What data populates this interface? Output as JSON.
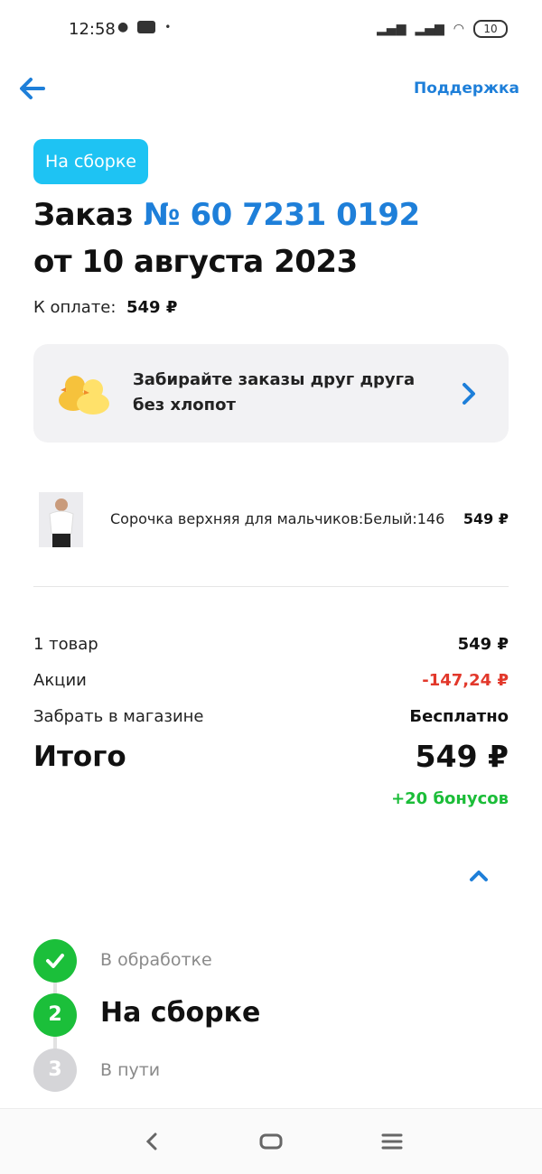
{
  "status_bar": {
    "time": "12:58",
    "battery": "10"
  },
  "header": {
    "support_label": "Поддержка"
  },
  "order": {
    "status_badge": "На сборке",
    "title_prefix": "Заказ",
    "number": "№ 60 7231 0192",
    "date": "от 10 августа 2023",
    "pay_label": "К оплате:",
    "pay_value": "549 ₽"
  },
  "promo_card": {
    "text": "Забирайте заказы друг друга без хлопот"
  },
  "product": {
    "name": "Сорочка верхняя для мальчиков:Белый:146",
    "price": "549 ₽"
  },
  "summary": {
    "items_label": "1 товар",
    "items_value": "549 ₽",
    "promos_label": "Акции",
    "promos_value": "-147,24 ₽",
    "pickup_label": "Забрать в магазине",
    "pickup_value": "Бесплатно",
    "total_label": "Итого",
    "total_value": "549 ₽",
    "bonus": "+20 бонусов"
  },
  "steps": [
    {
      "label": "В обработке",
      "state": "done"
    },
    {
      "num": "2",
      "label": "На сборке",
      "state": "active"
    },
    {
      "num": "3",
      "label": "В пути",
      "state": "todo"
    }
  ],
  "colors": {
    "accent": "#1e7fd9",
    "badge": "#1ec3f3",
    "success": "#1bbf3a",
    "discount": "#e2382b"
  }
}
